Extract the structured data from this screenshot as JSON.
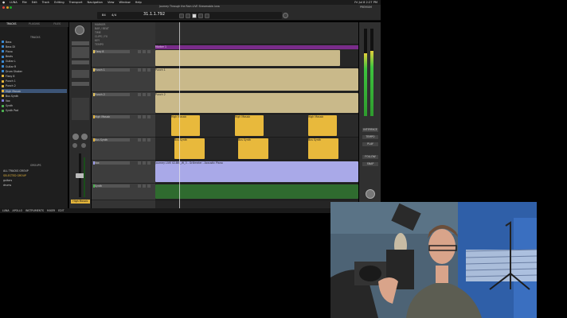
{
  "menu": {
    "items": [
      "LUNA",
      "File",
      "Edit",
      "Track",
      "Editing",
      "Transport",
      "Navigation",
      "View",
      "Window",
      "Help"
    ],
    "clock": "Fri Jul 8 2:27 PM",
    "apps_label": "PREMIUM"
  },
  "window": {
    "title": "Journey Through the Rain LIVE Streamable.luna"
  },
  "transport": {
    "counter": "31.1.1.792",
    "bpm": "84",
    "timesig": "4/4"
  },
  "browser": {
    "tabs": [
      "TRACKS",
      "PLUGINS",
      "FILES"
    ],
    "header": "TRACKS",
    "tracks": [
      {
        "name": "Bass",
        "color": "#3a8bd6"
      },
      {
        "name": "Bass DI",
        "color": "#3a8bd6"
      },
      {
        "name": "Piano",
        "color": "#3a8bd6"
      },
      {
        "name": "Beats",
        "color": "#3a8bd6"
      },
      {
        "name": "Guitar L",
        "color": "#3a8bd6"
      },
      {
        "name": "Guitar R",
        "color": "#3a8bd6"
      },
      {
        "name": "Drum Shaker",
        "color": "#3a8bd6"
      },
      {
        "name": "Flexy 8",
        "color": "#e3b43b"
      },
      {
        "name": "Punch 1",
        "color": "#e3b43b"
      },
      {
        "name": "Punch 2",
        "color": "#e3b43b"
      },
      {
        "name": "High Mosaic",
        "color": "#e3b43b"
      },
      {
        "name": "Bus Synth",
        "color": "#e3b43b"
      },
      {
        "name": "Vox",
        "color": "#7c7cd8"
      },
      {
        "name": "Synth",
        "color": "#4caf50"
      },
      {
        "name": "Synth Pad",
        "color": "#4caf50"
      }
    ],
    "groups_header": "GROUPS",
    "groups": [
      "ALL TRACKS GROUP",
      "SELECTED GROUP",
      "guitars",
      "drums"
    ]
  },
  "bottombar": {
    "items": [
      "LUNA",
      "APOLLO",
      "INSTRUMENTS",
      "MIXER",
      "EDIT"
    ]
  },
  "strip": {
    "name": "High Mosaic"
  },
  "arrangement": {
    "ruler_rows": [
      "MARKER",
      "BAR / BEAT",
      "TIME",
      "CLIPS / FX",
      "KEY",
      "TEMPO"
    ],
    "marker_label": "Marker 1",
    "tracks": [
      {
        "name": "Flexy 8",
        "color": "#e3c25a"
      },
      {
        "name": "Punch 1",
        "color": "#e3c25a"
      },
      {
        "name": "Punch 2",
        "color": "#e3c25a"
      },
      {
        "name": "High Mosaic",
        "color": "#e3b43b"
      },
      {
        "name": "Bus Synth",
        "color": "#e3b43b"
      },
      {
        "name": "Vox",
        "color": "#9b9be8"
      },
      {
        "name": "Synth",
        "color": "#4caf50"
      }
    ],
    "clip_labels": {
      "punch1": "Punch 1",
      "punch2": "Punch 2",
      "high": "High Mosaic",
      "bus": "Bus Synth",
      "vox": "Journey LIVE 02-BKJ_W_3 - Grillmeier - Acoustic Piano"
    }
  },
  "right_panel": {
    "buttons": [
      "INTERFACE",
      "TEMPO",
      "PLAY",
      "FOLLOW",
      "SNAP"
    ]
  }
}
